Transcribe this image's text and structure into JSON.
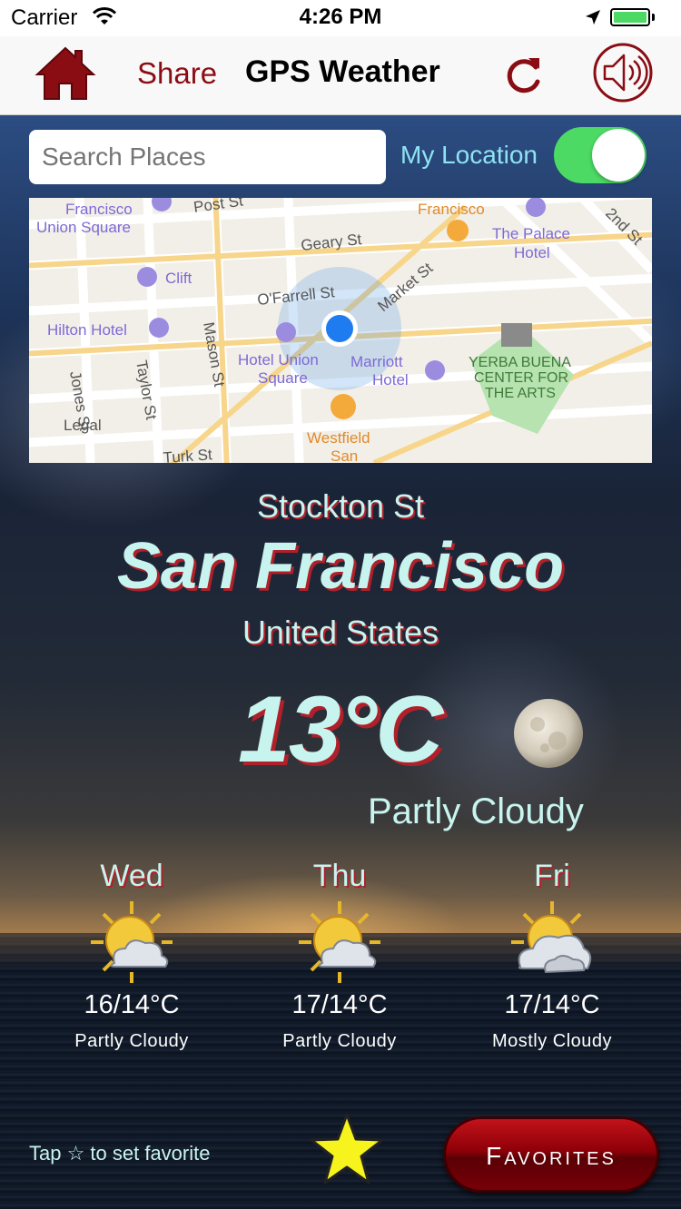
{
  "status_bar": {
    "carrier": "Carrier",
    "time": "4:26 PM"
  },
  "nav": {
    "share_label": "Share",
    "title": "GPS Weather"
  },
  "search": {
    "placeholder": "Search Places",
    "my_location_label": "My Location",
    "my_location_on": true
  },
  "map": {
    "labels": {
      "francisco_union_1": "Francisco",
      "francisco_union_2": "Union Square",
      "post_st": "Post St",
      "francisco_right": "Francisco",
      "palace_1": "The Palace",
      "palace_2": "Hotel",
      "second_st": "2nd St",
      "geary_st": "Geary St",
      "clift": "Clift",
      "ofarrell_st": "O'Farrell St",
      "market_st": "Market St",
      "hilton": "Hilton Hotel",
      "mason_st": "Mason St",
      "hotel_union_1": "Hotel Union",
      "hotel_union_2": "Square",
      "marriott_1": "Marriott",
      "marriott_2": "Hotel",
      "yerba_1": "YERBA BUENA",
      "yerba_2": "CENTER FOR",
      "yerba_3": "THE ARTS",
      "jones_st": "Jones St",
      "taylor_st": "Taylor St",
      "legal": "Legal",
      "westfield_1": "Westfield",
      "westfield_2": "San",
      "turk_st": "Turk St"
    }
  },
  "location": {
    "street": "Stockton St",
    "city": "San Francisco",
    "country": "United States"
  },
  "current": {
    "temperature": "13°C",
    "condition": "Partly Cloudy",
    "icon": "moon-icon"
  },
  "forecast": [
    {
      "day": "Wed",
      "temp": "16/14°C",
      "condition": "Partly Cloudy",
      "icon": "partly-cloudy-icon"
    },
    {
      "day": "Thu",
      "temp": "17/14°C",
      "condition": "Partly Cloudy",
      "icon": "partly-cloudy-icon"
    },
    {
      "day": "Fri",
      "temp": "17/14°C",
      "condition": "Mostly Cloudy",
      "icon": "mostly-cloudy-icon"
    }
  ],
  "bottom": {
    "hint": "Tap ☆ to set favorite",
    "favorites_label": "Favorites"
  },
  "colors": {
    "accent": "#8b0d14",
    "text": "#c8f4ef",
    "shadow": "#b0202a",
    "switch_on": "#4cd964"
  }
}
